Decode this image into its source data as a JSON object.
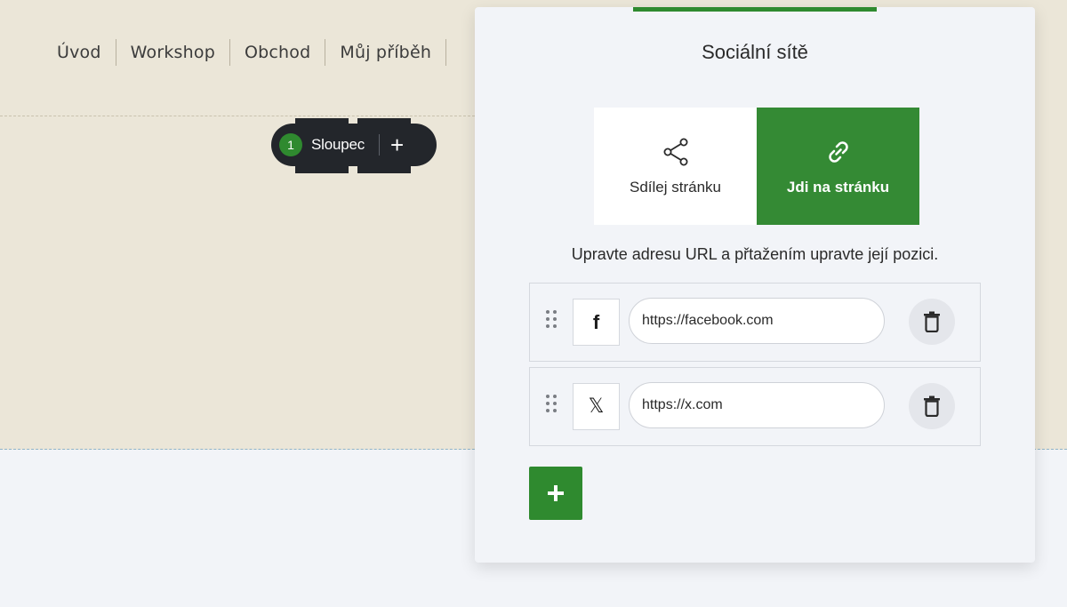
{
  "nav": {
    "items": [
      {
        "label": "Úvod"
      },
      {
        "label": "Workshop"
      },
      {
        "label": "Obchod"
      },
      {
        "label": "Můj příběh"
      }
    ]
  },
  "column_pill": {
    "number": "1",
    "label": "Sloupec",
    "add_label": "+"
  },
  "panel": {
    "title": "Sociální sítě",
    "modes": {
      "share": {
        "label": "Sdílej stránku",
        "icon": "share-icon"
      },
      "link": {
        "label": "Jdi na stránku",
        "icon": "link-icon",
        "selected": true
      }
    },
    "hint": "Upravte adresu URL a přtažením upravte její pozici.",
    "links": [
      {
        "network": "facebook",
        "icon": "facebook-icon",
        "glyph": "f",
        "url": "https://facebook.com"
      },
      {
        "network": "x",
        "icon": "x-icon",
        "glyph": "𝕏",
        "url": "https://x.com"
      }
    ],
    "add_button": {
      "icon": "plus-icon"
    }
  },
  "colors": {
    "accent_green": "#2f8a2f",
    "canvas_beige": "#ebe6d8",
    "panel_bg": "#f2f4f8",
    "pill_dark": "#23262b"
  }
}
